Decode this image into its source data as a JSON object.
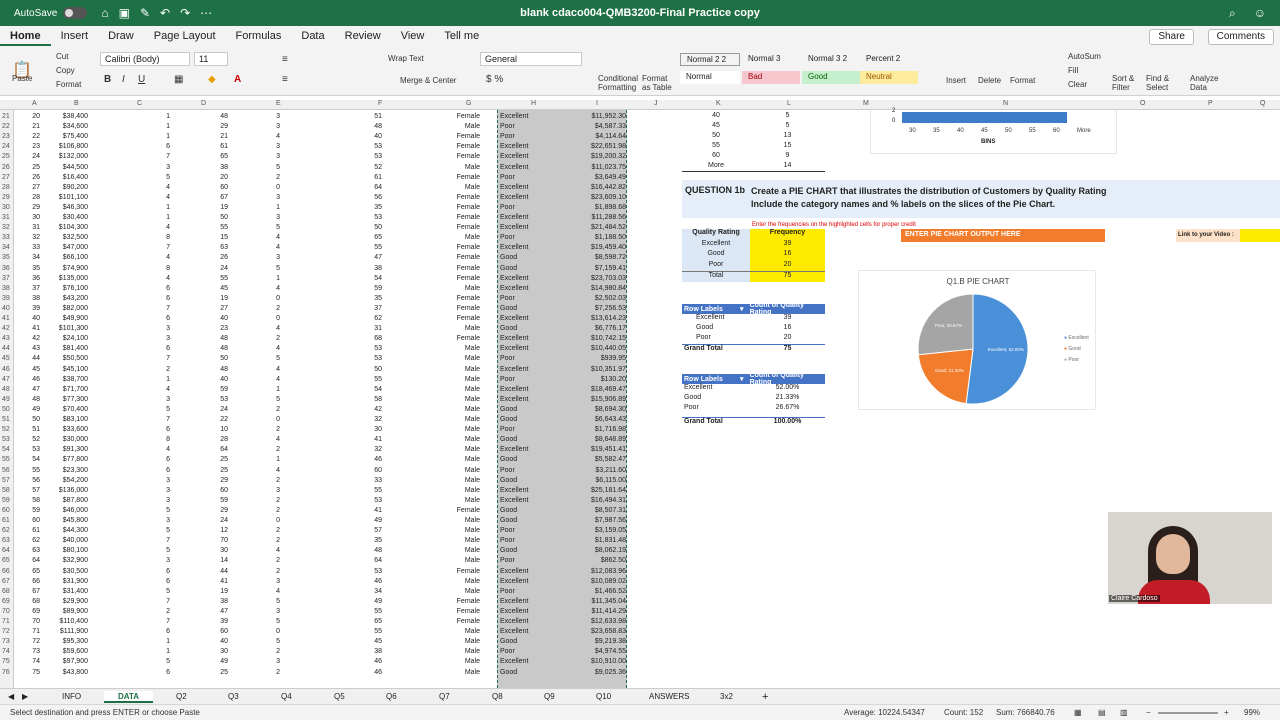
{
  "window": {
    "title": "blank cdaco004-QMB3200-Final Practice copy",
    "autosave_label": "AutoSave",
    "autosave_state": "OFF"
  },
  "menu_tabs": [
    "Home",
    "Insert",
    "Draw",
    "Page Layout",
    "Formulas",
    "Data",
    "Review",
    "View",
    "Tell me"
  ],
  "share_label": "Share",
  "comments_label": "Comments",
  "ribbon": {
    "cut": "Cut",
    "copy": "Copy",
    "paste": "Paste",
    "format": "Format",
    "font_name": "Calibri (Body)",
    "font_size": "11",
    "wrap_text": "Wrap Text",
    "merge_center": "Merge & Center",
    "number_format": "General",
    "conditional_formatting": "Conditional Formatting",
    "format_as_table": "Format as Table",
    "styles": [
      {
        "name": "Normal 2 2",
        "bg": "#ffffff"
      },
      {
        "name": "Normal 3",
        "bg": "#f3f3f3"
      },
      {
        "name": "Normal 3 2",
        "bg": "#f3f3f3"
      },
      {
        "name": "Percent 2",
        "bg": "#f3f3f3"
      },
      {
        "name": "Normal",
        "bg": "#ffffff"
      },
      {
        "name": "Bad",
        "bg": "#f8c7ce"
      },
      {
        "name": "Good",
        "bg": "#c6efce"
      },
      {
        "name": "Neutral",
        "bg": "#ffeb9c"
      }
    ],
    "insert": "Insert",
    "delete": "Delete",
    "format_cells": "Format",
    "autosum": "AutoSum",
    "fill": "Fill",
    "clear": "Clear",
    "sort_filter": "Sort & Filter",
    "find_select": "Find & Select",
    "analyze_data": "Analyze Data"
  },
  "columns": [
    "A",
    "B",
    "C",
    "D",
    "E",
    "F",
    "G",
    "H",
    "I",
    "J",
    "K",
    "L",
    "M",
    "N",
    "O",
    "P",
    "Q"
  ],
  "rows": [
    [
      "21",
      "20",
      "$38,400",
      "1",
      "48",
      "3",
      "51",
      "Female",
      "Excellent",
      "$11,952.30"
    ],
    [
      "22",
      "21",
      "$34,600",
      "1",
      "29",
      "3",
      "48",
      "Male",
      "Poor",
      "$4,587.33"
    ],
    [
      "23",
      "22",
      "$75,400",
      "1",
      "21",
      "4",
      "40",
      "Female",
      "Poor",
      "$4,114.64"
    ],
    [
      "24",
      "23",
      "$106,800",
      "6",
      "61",
      "3",
      "53",
      "Female",
      "Excellent",
      "$22,651.98"
    ],
    [
      "25",
      "24",
      "$132,000",
      "7",
      "65",
      "3",
      "53",
      "Female",
      "Excellent",
      "$19,200.32"
    ],
    [
      "26",
      "25",
      "$44,500",
      "3",
      "38",
      "5",
      "52",
      "Male",
      "Excellent",
      "$11,023.75"
    ],
    [
      "27",
      "26",
      "$16,400",
      "5",
      "20",
      "2",
      "61",
      "Female",
      "Poor",
      "$3,649.49"
    ],
    [
      "28",
      "27",
      "$90,200",
      "4",
      "60",
      "0",
      "64",
      "Male",
      "Excellent",
      "$16,442.82"
    ],
    [
      "29",
      "28",
      "$101,100",
      "4",
      "67",
      "3",
      "56",
      "Female",
      "Excellent",
      "$23,609.10"
    ],
    [
      "30",
      "29",
      "$46,300",
      "1",
      "19",
      "1",
      "35",
      "Female",
      "Poor",
      "$1,898.68"
    ],
    [
      "31",
      "30",
      "$30,400",
      "1",
      "50",
      "3",
      "53",
      "Female",
      "Excellent",
      "$11,288.56"
    ],
    [
      "32",
      "31",
      "$104,300",
      "4",
      "55",
      "5",
      "50",
      "Female",
      "Excellent",
      "$21,484.52"
    ],
    [
      "33",
      "32",
      "$32,500",
      "8",
      "15",
      "4",
      "65",
      "Male",
      "Poor",
      "$1,188.50"
    ],
    [
      "34",
      "33",
      "$47,000",
      "7",
      "63",
      "4",
      "55",
      "Female",
      "Excellent",
      "$19,459.40"
    ],
    [
      "35",
      "34",
      "$66,100",
      "4",
      "26",
      "3",
      "47",
      "Female",
      "Good",
      "$8,598.72"
    ],
    [
      "36",
      "35",
      "$74,900",
      "8",
      "24",
      "5",
      "38",
      "Female",
      "Good",
      "$7,159.41"
    ],
    [
      "37",
      "36",
      "$135,000",
      "4",
      "55",
      "1",
      "54",
      "Female",
      "Excellent",
      "$23,703.03"
    ],
    [
      "38",
      "37",
      "$76,100",
      "6",
      "45",
      "4",
      "59",
      "Male",
      "Excellent",
      "$14,980.84"
    ],
    [
      "39",
      "38",
      "$43,200",
      "6",
      "19",
      "0",
      "35",
      "Female",
      "Poor",
      "$2,502.03"
    ],
    [
      "40",
      "39",
      "$82,000",
      "7",
      "27",
      "2",
      "37",
      "Female",
      "Good",
      "$7,256.53"
    ],
    [
      "41",
      "40",
      "$49,900",
      "6",
      "40",
      "0",
      "62",
      "Female",
      "Excellent",
      "$13,614.23"
    ],
    [
      "42",
      "41",
      "$101,300",
      "3",
      "23",
      "4",
      "31",
      "Male",
      "Good",
      "$6,776.17"
    ],
    [
      "43",
      "42",
      "$24,100",
      "3",
      "48",
      "2",
      "68",
      "Female",
      "Excellent",
      "$10,742.15"
    ],
    [
      "44",
      "43",
      "$81,400",
      "6",
      "48",
      "4",
      "53",
      "Male",
      "Excellent",
      "$10,440.05"
    ],
    [
      "45",
      "44",
      "$50,500",
      "7",
      "50",
      "5",
      "53",
      "Male",
      "Poor",
      "$939.95"
    ],
    [
      "46",
      "45",
      "$45,100",
      "2",
      "48",
      "4",
      "50",
      "Male",
      "Excellent",
      "$10,351.97"
    ],
    [
      "47",
      "46",
      "$38,700",
      "1",
      "40",
      "4",
      "55",
      "Male",
      "Poor",
      "$130.20"
    ],
    [
      "48",
      "47",
      "$71,700",
      "4",
      "59",
      "1",
      "54",
      "Male",
      "Excellent",
      "$18,469.47"
    ],
    [
      "49",
      "48",
      "$77,300",
      "3",
      "53",
      "5",
      "58",
      "Male",
      "Excellent",
      "$15,906.89"
    ],
    [
      "50",
      "49",
      "$70,400",
      "5",
      "24",
      "2",
      "42",
      "Male",
      "Good",
      "$8,694.30"
    ],
    [
      "51",
      "50",
      "$83,100",
      "7",
      "22",
      "0",
      "32",
      "Male",
      "Good",
      "$6,643.43"
    ],
    [
      "52",
      "51",
      "$33,600",
      "6",
      "10",
      "2",
      "30",
      "Male",
      "Poor",
      "$1,716.98"
    ],
    [
      "53",
      "52",
      "$30,000",
      "8",
      "28",
      "4",
      "41",
      "Male",
      "Good",
      "$8,648.89"
    ],
    [
      "54",
      "53",
      "$91,300",
      "4",
      "64",
      "2",
      "32",
      "Male",
      "Excellent",
      "$19,451.41"
    ],
    [
      "55",
      "54",
      "$77,800",
      "6",
      "25",
      "1",
      "46",
      "Male",
      "Good",
      "$5,582.47"
    ],
    [
      "56",
      "55",
      "$23,300",
      "6",
      "25",
      "4",
      "60",
      "Male",
      "Poor",
      "$3,211.60"
    ],
    [
      "57",
      "56",
      "$54,200",
      "3",
      "29",
      "2",
      "33",
      "Male",
      "Good",
      "$6,115.00"
    ],
    [
      "58",
      "57",
      "$136,000",
      "3",
      "60",
      "3",
      "55",
      "Male",
      "Excellent",
      "$25,181.64"
    ],
    [
      "59",
      "58",
      "$87,800",
      "3",
      "59",
      "2",
      "53",
      "Male",
      "Excellent",
      "$16,494.31"
    ],
    [
      "60",
      "59",
      "$46,000",
      "5",
      "29",
      "2",
      "41",
      "Female",
      "Good",
      "$8,507.31"
    ],
    [
      "61",
      "60",
      "$45,800",
      "3",
      "24",
      "0",
      "49",
      "Male",
      "Good",
      "$7,987.56"
    ],
    [
      "62",
      "61",
      "$44,300",
      "5",
      "12",
      "2",
      "57",
      "Male",
      "Poor",
      "$3,159.05"
    ],
    [
      "63",
      "62",
      "$40,000",
      "7",
      "70",
      "2",
      "35",
      "Male",
      "Poor",
      "$1,831.48"
    ],
    [
      "64",
      "63",
      "$80,100",
      "5",
      "30",
      "4",
      "48",
      "Male",
      "Good",
      "$8,062.19"
    ],
    [
      "65",
      "64",
      "$32,900",
      "3",
      "14",
      "2",
      "64",
      "Male",
      "Poor",
      "$862.50"
    ],
    [
      "66",
      "65",
      "$30,500",
      "6",
      "44",
      "2",
      "53",
      "Female",
      "Excellent",
      "$12,083.96"
    ],
    [
      "67",
      "66",
      "$31,900",
      "6",
      "41",
      "3",
      "46",
      "Male",
      "Excellent",
      "$10,089.02"
    ],
    [
      "68",
      "67",
      "$31,400",
      "5",
      "19",
      "4",
      "34",
      "Male",
      "Poor",
      "$1,466.52"
    ],
    [
      "69",
      "68",
      "$29,900",
      "7",
      "38",
      "5",
      "49",
      "Female",
      "Excellent",
      "$11,345.04"
    ],
    [
      "70",
      "69",
      "$89,900",
      "2",
      "47",
      "3",
      "55",
      "Female",
      "Excellent",
      "$11,414.29"
    ],
    [
      "71",
      "70",
      "$110,400",
      "7",
      "39",
      "5",
      "65",
      "Female",
      "Excellent",
      "$12,633.98"
    ],
    [
      "72",
      "71",
      "$111,900",
      "6",
      "60",
      "0",
      "55",
      "Male",
      "Excellent",
      "$23,658.83"
    ],
    [
      "73",
      "72",
      "$95,300",
      "1",
      "40",
      "5",
      "45",
      "Male",
      "Good",
      "$9,219.38"
    ],
    [
      "74",
      "73",
      "$59,600",
      "1",
      "30",
      "2",
      "38",
      "Male",
      "Poor",
      "$4,974.55"
    ],
    [
      "75",
      "74",
      "$97,900",
      "5",
      "49",
      "3",
      "46",
      "Male",
      "Excellent",
      "$10,910.00"
    ],
    [
      "76",
      "75",
      "$43,800",
      "6",
      "25",
      "2",
      "46",
      "Male",
      "Good",
      "$9,025.36"
    ]
  ],
  "bins_table": [
    [
      "40",
      "5"
    ],
    [
      "45",
      "5"
    ],
    [
      "50",
      "13"
    ],
    [
      "55",
      "15"
    ],
    [
      "60",
      "9"
    ],
    [
      "More",
      "14"
    ]
  ],
  "histogram": {
    "x_ticks": [
      "30",
      "35",
      "40",
      "45",
      "50",
      "55",
      "60",
      "More"
    ],
    "x_title": "BINS",
    "y_ticks": [
      "2",
      "0"
    ]
  },
  "question": {
    "label": "QUESTION 1b",
    "line1": "Create a PIE CHART that illustrates the distribution of Customers by Quality Rating",
    "line2": "Include the category names and % labels on the slices of the Pie Chart.",
    "note": "Enter the frequencies on the highlighted cells for proper credit",
    "output_label": "ENTER PIE CHART OUTPUT HERE",
    "video_label": "Link to your Video :"
  },
  "freq_table": {
    "headers": [
      "Quality Rating",
      "Frequency"
    ],
    "rows": [
      [
        "Excellent",
        "39"
      ],
      [
        "Good",
        "16"
      ],
      [
        "Poor",
        "20"
      ]
    ],
    "total": [
      "Total",
      "75"
    ]
  },
  "pivot1": {
    "headers": [
      "Row Labels",
      "Count of Quality Rating"
    ],
    "rows": [
      [
        "Excellent",
        "39"
      ],
      [
        "Good",
        "16"
      ],
      [
        "Poor",
        "20"
      ]
    ],
    "total": [
      "Grand Total",
      "75"
    ]
  },
  "pivot2": {
    "headers": [
      "Row Labels",
      "Count of Quality Rating"
    ],
    "rows": [
      [
        "Excellent",
        "52.00%"
      ],
      [
        "Good",
        "21.33%"
      ],
      [
        "Poor",
        "26.67%"
      ]
    ],
    "total": [
      "Grand Total",
      "100.00%"
    ]
  },
  "chart_data": {
    "type": "pie",
    "title": "Q1.B PIE CHART",
    "categories": [
      "Excellent",
      "Good",
      "Poor"
    ],
    "values": [
      52.0,
      21.33,
      26.67
    ],
    "labels": [
      "Excellent, 52.00%",
      "Good, 21.33%",
      "Poor, 26.67%"
    ],
    "colors": [
      "#4a90d9",
      "#f07c2c",
      "#a5a5a5"
    ],
    "legend": "right"
  },
  "webcam_name": "Claire Cardoso",
  "sheet_tabs": [
    "INFO",
    "DATA",
    "Q2",
    "Q3",
    "Q4",
    "Q5",
    "Q6",
    "Q7",
    "Q8",
    "Q9",
    "Q10",
    "ANSWERS",
    "3x2"
  ],
  "active_sheet": "DATA",
  "status": {
    "message": "Select destination and press ENTER or choose Paste",
    "average": "Average: 10224.54347",
    "count": "Count: 152",
    "sum": "Sum: 766840.76",
    "zoom": "99%"
  }
}
